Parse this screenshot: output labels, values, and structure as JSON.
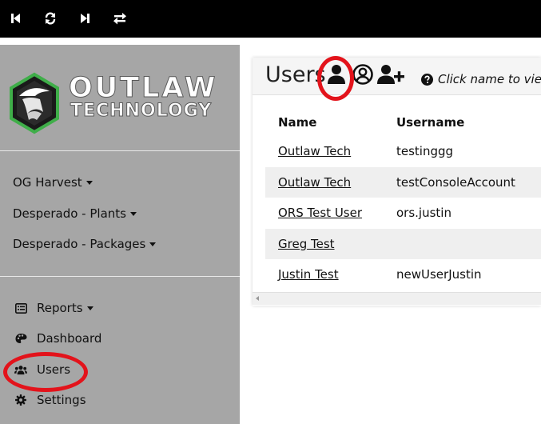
{
  "toolbar": {
    "icons": [
      "skip-back-icon",
      "refresh-icon",
      "skip-forward-icon",
      "swap-icon"
    ]
  },
  "brand": {
    "line1": "OUTLAW",
    "line2": "TECHNOLOGY",
    "accent": "#3fae49"
  },
  "sidebar": {
    "groups": [
      {
        "label": "OG Harvest"
      },
      {
        "label": "Desperado - Plants"
      },
      {
        "label": "Desperado - Packages"
      }
    ],
    "menu": [
      {
        "label": "Reports",
        "icon": "list-icon",
        "dropdown": true
      },
      {
        "label": "Dashboard",
        "icon": "palette-icon"
      },
      {
        "label": "Users",
        "icon": "users-icon"
      },
      {
        "label": "Settings",
        "icon": "gear-icon"
      }
    ]
  },
  "panel": {
    "title": "Users",
    "help_text": "Click name to vie",
    "columns": [
      "Name",
      "Username"
    ],
    "rows": [
      {
        "name": "Outlaw Tech",
        "username": "testinggg"
      },
      {
        "name": "Outlaw Tech",
        "username": "testConsoleAccount"
      },
      {
        "name": "ORS Test User",
        "username": "ors.justin"
      },
      {
        "name": "Greg Test",
        "username": ""
      },
      {
        "name": "Justin Test",
        "username": "newUserJustin"
      }
    ]
  },
  "colors": {
    "sidebar_bg": "#a6a6a6",
    "toolbar_bg": "#000000",
    "annotation": "#e3131b"
  }
}
